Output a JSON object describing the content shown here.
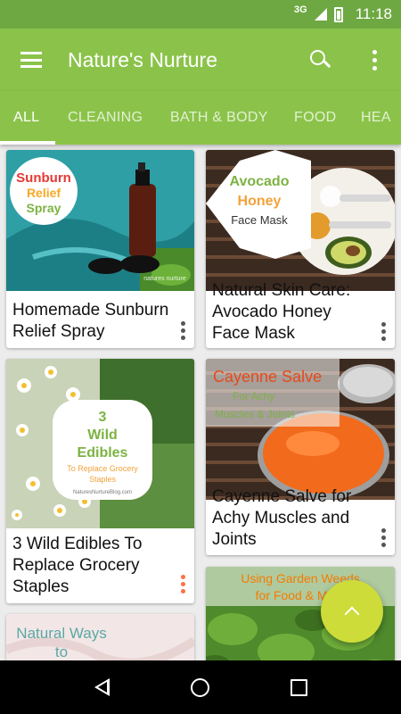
{
  "status_bar": {
    "network": "3G",
    "time": "11:18"
  },
  "app_bar": {
    "title": "Nature's Nurture"
  },
  "tabs": [
    {
      "label": "ALL",
      "active": true
    },
    {
      "label": "CLEANING",
      "active": false
    },
    {
      "label": "BATH & BODY",
      "active": false
    },
    {
      "label": "FOOD",
      "active": false
    },
    {
      "label": "HEA",
      "active": false
    }
  ],
  "cards": [
    {
      "title": "Homemade Sunburn Relief Spray",
      "image": {
        "overlay_text": [
          "Sunburn",
          "Relief",
          "Spray"
        ],
        "watermark": "natures nurture"
      }
    },
    {
      "title": "Natural Skin Care: Avocado Honey Face Mask",
      "image": {
        "overlay_text": [
          "Avocado",
          "Honey",
          "Face Mask"
        ]
      }
    },
    {
      "title": "3 Wild Edibles To Replace Grocery Staples",
      "image": {
        "overlay_text": [
          "3",
          "Wild",
          "Edibles",
          "To Replace Grocery",
          "Staples",
          "NaturesNurtureBlog.com"
        ]
      }
    },
    {
      "title": "Cayenne Salve for Achy Muscles and Joints",
      "image": {
        "overlay_text": [
          "Cayenne Salve",
          "For Achy",
          "Muscles & Joints"
        ]
      }
    },
    {
      "title": "",
      "image": {
        "overlay_text": [
          "Natural Ways",
          "to"
        ]
      }
    },
    {
      "title": "",
      "image": {
        "overlay_text": [
          "Using Garden Weeds",
          "for Food & Me"
        ]
      }
    }
  ],
  "colors": {
    "status_bar": "#6ea842",
    "app_bar": "#8bc34a",
    "fab": "#cddc39",
    "accent_more": "#ff7043"
  },
  "icons": [
    "menu-icon",
    "search-icon",
    "overflow-menu-icon",
    "more-vert-icon",
    "chevron-up-icon",
    "back-icon",
    "home-icon",
    "recent-apps-icon"
  ]
}
